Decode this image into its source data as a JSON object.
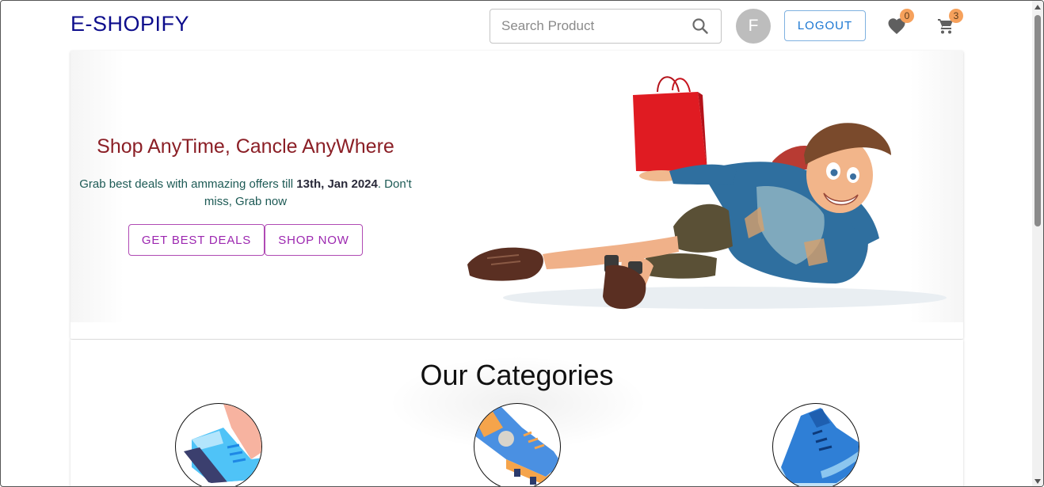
{
  "header": {
    "brand": "E-SHOPIFY",
    "search_placeholder": "Search Product",
    "avatar_initial": "F",
    "logout_label": "LOGOUT",
    "wishlist_count": "0",
    "cart_count": "3"
  },
  "hero": {
    "title": "Shop AnyTime, Cancle AnyWhere",
    "text_before": "Grab best deals with ammazing offers till ",
    "text_bold": "13th, Jan 2024",
    "text_after": ". Don't miss, Grab now",
    "primary_button": "GET BEST DEALS",
    "secondary_button": "SHOP NOW"
  },
  "categories": {
    "title": "Our Categories",
    "items": [
      {
        "icon": "running-shoe-icon"
      },
      {
        "icon": "football-boot-icon"
      },
      {
        "icon": "sneaker-icon"
      }
    ]
  },
  "colors": {
    "brand": "#0d0d8c",
    "hero_title": "#8b1f26",
    "outline_button": "#9c27b0",
    "logout": "#1976d2",
    "badge": "#f6a15c"
  },
  "icons": {
    "search": "search-icon",
    "wishlist": "heart-icon",
    "cart": "cart-icon"
  }
}
